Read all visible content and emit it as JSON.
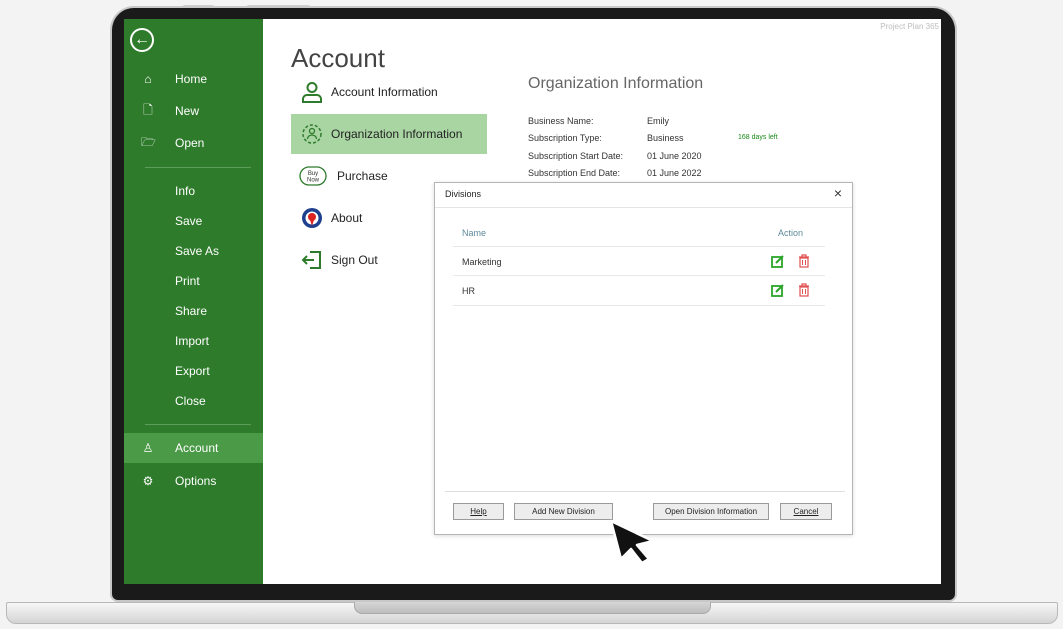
{
  "app": {
    "corner_title": "Project Plan 365"
  },
  "sidebar": {
    "items": [
      {
        "label": "Home",
        "icon": "home-icon",
        "glyph": "⌂"
      },
      {
        "label": "New",
        "icon": "new-document-icon",
        "glyph": "🗋"
      },
      {
        "label": "Open",
        "icon": "folder-open-icon",
        "glyph": "🗁"
      },
      {
        "label": "Info"
      },
      {
        "label": "Save"
      },
      {
        "label": "Save As"
      },
      {
        "label": "Print"
      },
      {
        "label": "Share"
      },
      {
        "label": "Import"
      },
      {
        "label": "Export"
      },
      {
        "label": "Close"
      },
      {
        "label": "Account",
        "icon": "account-icon",
        "glyph": "♙",
        "active": true
      },
      {
        "label": "Options",
        "icon": "gear-icon",
        "glyph": "⚙"
      }
    ]
  },
  "account": {
    "title": "Account",
    "items": [
      {
        "label": "Account Information",
        "icon": "person-icon"
      },
      {
        "label": "Organization Information",
        "icon": "organization-icon",
        "active": true
      },
      {
        "label": "Purchase",
        "icon": "buy-now-icon",
        "icon_text_1": "Buy",
        "icon_text_2": "Now"
      },
      {
        "label": "About",
        "icon": "about-icon"
      },
      {
        "label": "Sign Out",
        "icon": "sign-out-icon"
      }
    ]
  },
  "org_info": {
    "title": "Organization Information",
    "rows": [
      {
        "label": "Business Name:",
        "value": "Emily"
      },
      {
        "label": "Subscription Type:",
        "value": "Business"
      },
      {
        "label": "Subscription Start Date:",
        "value": "01 June 2020"
      },
      {
        "label": "Subscription End Date:",
        "value": "01 June 2022"
      }
    ],
    "days_left": "168 days left"
  },
  "dialog": {
    "title": "Divisions",
    "close_glyph": "×",
    "columns": {
      "name": "Name",
      "action": "Action"
    },
    "rows": [
      {
        "name": "Marketing"
      },
      {
        "name": "HR"
      }
    ],
    "buttons": {
      "help": "Help",
      "add": "Add New Division",
      "open": "Open Division Information",
      "cancel": "Cancel"
    }
  },
  "colors": {
    "sidebar_bg": "#2f7b2c",
    "sidebar_active": "#4b9a47",
    "account_active": "#a9d5a3",
    "edit_icon": "#2aa52a",
    "delete_icon": "#e05050"
  }
}
